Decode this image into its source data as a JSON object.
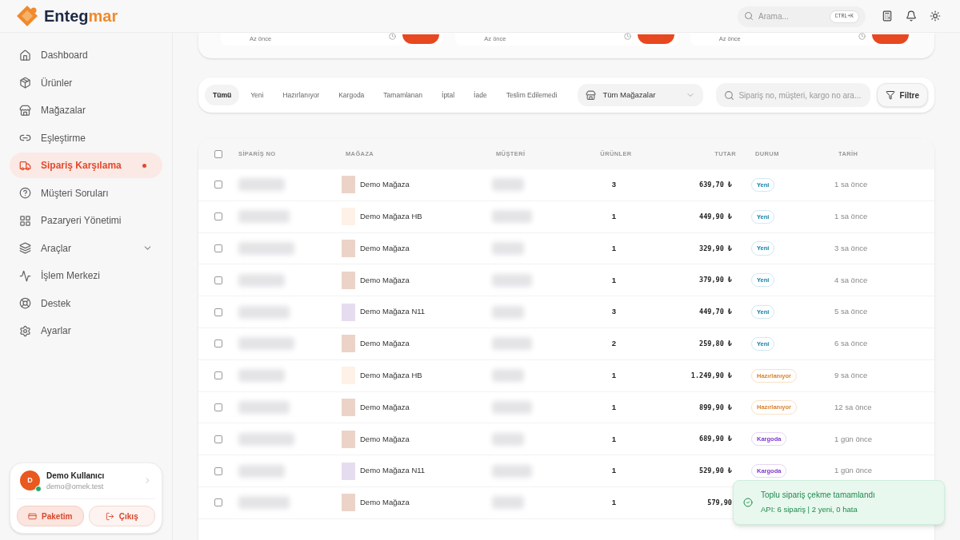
{
  "brand": {
    "name_part1": "Enteg",
    "name_part2": "mar"
  },
  "header": {
    "search_placeholder": "Arama...",
    "shortcut": "CTRL+K"
  },
  "sidebar": {
    "items": [
      {
        "label": "Dashboard",
        "selected": false
      },
      {
        "label": "Ürünler",
        "selected": false
      },
      {
        "label": "Mağazalar",
        "selected": false
      },
      {
        "label": "Eşleştirme",
        "selected": false
      },
      {
        "label": "Sipariş Karşılama",
        "selected": true,
        "dot": true
      },
      {
        "label": "Müşteri Soruları",
        "selected": false
      },
      {
        "label": "Pazaryeri Yönetimi",
        "selected": false
      },
      {
        "label": "Araçlar",
        "selected": false,
        "expandable": true
      },
      {
        "label": "İşlem Merkezi",
        "selected": false
      },
      {
        "label": "Destek",
        "selected": false
      },
      {
        "label": "Ayarlar",
        "selected": false
      }
    ]
  },
  "user": {
    "initial": "D",
    "name": "Demo Kullanıcı",
    "email": "demo@ornek.test",
    "online": true,
    "buttons": [
      {
        "label": "Paketim",
        "kind": "package"
      },
      {
        "label": "Çıkış",
        "kind": "logout"
      }
    ]
  },
  "recent_cards": [
    {
      "time": "Az önce"
    },
    {
      "time": "Az önce"
    },
    {
      "time": "Az önce"
    }
  ],
  "filters": {
    "tabs": [
      {
        "label": "Tümü",
        "selected": true
      },
      {
        "label": "Yeni",
        "selected": false
      },
      {
        "label": "Hazırlanıyor",
        "selected": false
      },
      {
        "label": "Kargoda",
        "selected": false
      },
      {
        "label": "Tamamlanan",
        "selected": false
      },
      {
        "label": "İptal",
        "selected": false
      },
      {
        "label": "İade",
        "selected": false
      },
      {
        "label": "Teslim Edilemedi",
        "selected": false
      }
    ],
    "store_select": "Tüm Mağazalar",
    "search_placeholder": "Sipariş no, müşteri, kargo no ara...",
    "filter_button": "Filtre"
  },
  "table": {
    "select_all_checked": false,
    "columns": [
      "SİPARİŞ NO",
      "MAĞAZA",
      "MÜŞTERİ",
      "ÜRÜNLER",
      "TUTAR",
      "DURUM",
      "TARİH"
    ],
    "rows": [
      {
        "store": "Demo Mağaza",
        "color": "#ecd3c8",
        "items": "3",
        "amount": "639,70 ₺",
        "status": "Yeni",
        "kind": "new",
        "date": "1 sa önce",
        "checked": false
      },
      {
        "store": "Demo Mağaza HB",
        "color": "#fdf1e8",
        "items": "1",
        "amount": "449,90 ₺",
        "status": "Yeni",
        "kind": "new",
        "date": "1 sa önce",
        "checked": false
      },
      {
        "store": "Demo Mağaza",
        "color": "#ecd3c8",
        "items": "1",
        "amount": "329,90 ₺",
        "status": "Yeni",
        "kind": "new",
        "date": "3 sa önce",
        "checked": false
      },
      {
        "store": "Demo Mağaza",
        "color": "#ecd3c8",
        "items": "1",
        "amount": "379,90 ₺",
        "status": "Yeni",
        "kind": "new",
        "date": "4 sa önce",
        "checked": false
      },
      {
        "store": "Demo Mağaza N11",
        "color": "#e6dcef",
        "items": "3",
        "amount": "449,70 ₺",
        "status": "Yeni",
        "kind": "new",
        "date": "5 sa önce",
        "checked": false
      },
      {
        "store": "Demo Mağaza",
        "color": "#ecd3c8",
        "items": "2",
        "amount": "259,80 ₺",
        "status": "Yeni",
        "kind": "new",
        "date": "6 sa önce",
        "checked": false
      },
      {
        "store": "Demo Mağaza HB",
        "color": "#fdf1e8",
        "items": "1",
        "amount": "1.249,90 ₺",
        "status": "Hazırlanıyor",
        "kind": "preparing",
        "date": "9 sa önce",
        "checked": false
      },
      {
        "store": "Demo Mağaza",
        "color": "#ecd3c8",
        "items": "1",
        "amount": "899,90 ₺",
        "status": "Hazırlanıyor",
        "kind": "preparing",
        "date": "12 sa önce",
        "checked": false
      },
      {
        "store": "Demo Mağaza",
        "color": "#ecd3c8",
        "items": "1",
        "amount": "689,90 ₺",
        "status": "Kargoda",
        "kind": "shipping",
        "date": "1 gün önce",
        "checked": false
      },
      {
        "store": "Demo Mağaza N11",
        "color": "#e6dcef",
        "items": "1",
        "amount": "529,90 ₺",
        "status": "Kargoda",
        "kind": "shipping",
        "date": "1 gün önce",
        "checked": false
      },
      {
        "store": "Demo Mağaza",
        "color": "#ecd3c8",
        "items": "1",
        "amount": "579,90",
        "checked": false
      }
    ]
  },
  "toast": {
    "title": "Toplu sipariş çekme tamamlandı",
    "message": "API: 6 sipariş | 2 yeni, 0 hata"
  }
}
